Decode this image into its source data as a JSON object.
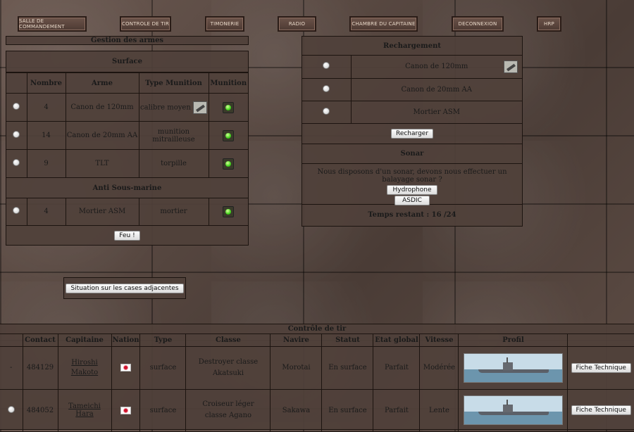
{
  "nav": [
    "Salle de commandement",
    "Controle de tir",
    "Timonerie",
    "Radio",
    "Chambre du capitaine",
    "Deconnexion",
    "HRP"
  ],
  "weapons": {
    "title": "Gestion des armes",
    "surface_title": "Surface",
    "headers": [
      "Nombre",
      "Arme",
      "Type Munition",
      "Munition"
    ],
    "rows": [
      {
        "nombre": "4",
        "arme": "Canon de 120mm",
        "munition": "calibre moyen"
      },
      {
        "nombre": "14",
        "arme": "Canon de 20mm AA",
        "munition": "munition mitrailleuse"
      },
      {
        "nombre": "9",
        "arme": "TLT",
        "munition": "torpille"
      }
    ],
    "asm_title": "Anti Sous-marine",
    "asm_row": {
      "nombre": "4",
      "arme": "Mortier ASM",
      "munition": "mortier"
    },
    "fire_button": "Feu !"
  },
  "reload": {
    "title": "Rechargement",
    "items": [
      "Canon de 120mm",
      "Canon de 20mm AA",
      "Mortier ASM"
    ],
    "button": "Recharger"
  },
  "sonar": {
    "title": "Sonar",
    "question": "Nous disposons d'un sonar, devons nous effectuer un balayage sonar ?",
    "button_hydrophone": "Hydrophone",
    "button_asdic": "ASDIC"
  },
  "time": {
    "label": "Temps restant : 16 /24"
  },
  "adjacent_button": "Situation sur les cases adjacentes",
  "fire_control": {
    "title": "Contrôle de tir",
    "headers": [
      "Contact",
      "Capitaine",
      "Nation",
      "Type",
      "Classe",
      "Navire",
      "Statut",
      "Etat global",
      "Vitesse",
      "Profil"
    ],
    "rows": [
      {
        "select": "-",
        "contact": "484129",
        "capitaine": "Hiroshi Makoto",
        "type": "surface",
        "classe": "Destroyer classe Akatsuki",
        "navire": "Morotai",
        "statut": "En surface",
        "etat": "Parfait",
        "vitesse": "Modérée",
        "fiche": "Fiche Technique"
      },
      {
        "select": "",
        "contact": "484052",
        "capitaine": "Tameichi Hara",
        "type": "surface",
        "classe": "Croiseur léger classe Agano",
        "navire": "Sakawa",
        "statut": "En surface",
        "etat": "Parfait",
        "vitesse": "Lente",
        "fiche": "Fiche Technique"
      }
    ]
  },
  "colors": {
    "led_green": "#3fd11a",
    "japan_red": "#d0102a",
    "panel": "#50413a"
  }
}
